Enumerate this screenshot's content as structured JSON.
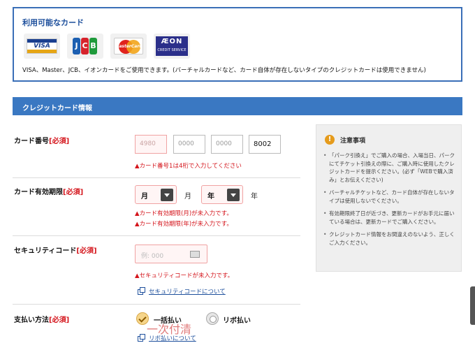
{
  "available_cards": {
    "title": "利用可能なカード",
    "logos": [
      {
        "name": "VISA",
        "text": "VISA"
      },
      {
        "name": "JCB",
        "letters": [
          "J",
          "C",
          "B"
        ]
      },
      {
        "name": "MasterCard",
        "text": "MasterCard"
      },
      {
        "name": "AEON",
        "text": "ÆON",
        "subtext": "CREDIT SERVICE"
      }
    ],
    "note": "VISA、Master、JCB、イオンカードをご使用できます。(バーチャルカードなど、カード自体が存在しないタイプのクレジットカードは使用できません)"
  },
  "section": {
    "title": "クレジットカード情報"
  },
  "required_mark": "[必須]",
  "card_number": {
    "label": "カード番号",
    "fields": [
      "4980",
      "0000",
      "0000",
      "8002"
    ],
    "error": "▲カード番号1は4桁で入力してください"
  },
  "expiry": {
    "label": "カード有効期限",
    "month_value": "月",
    "month_unit": "月",
    "year_value": "年",
    "year_unit": "年",
    "errors": [
      "▲カード有効期限(月)が未入力です。",
      "▲カード有効期限(年)が未入力です。"
    ]
  },
  "security_code": {
    "label": "セキュリティコード",
    "placeholder": "例: 000",
    "error": "▲セキュリティコードが未入力です。",
    "help_link": "セキュリティコードについて"
  },
  "payment_method": {
    "label": "支払い方法",
    "options": [
      {
        "label": "一括払い",
        "selected": true
      },
      {
        "label": "リボ払い",
        "selected": false
      }
    ],
    "overlay": "一次付清",
    "help_link": "リボ払いについて"
  },
  "notes": {
    "title": "注意事項",
    "items": [
      "「パーク引換え」でご購入の場合、入場当日、パークにてチケット引換えの際に、ご購入時に使用したクレジットカードを提示ください。(必ず「WEBで購入済み」とお伝えください)",
      "バーチャルチケットなど、カード自体が存在しないタイプは使用しないでください。",
      "有効期限終了日が近づき、更新カードがお手元に届いている場合は、更新カードでご購入ください。",
      "クレジットカード情報をお間違えのないよう、正しくご入力ください。"
    ]
  },
  "colors": {
    "accent_blue": "#3a78c2",
    "error_red": "#d4141b",
    "link_blue": "#1d4f9c"
  }
}
